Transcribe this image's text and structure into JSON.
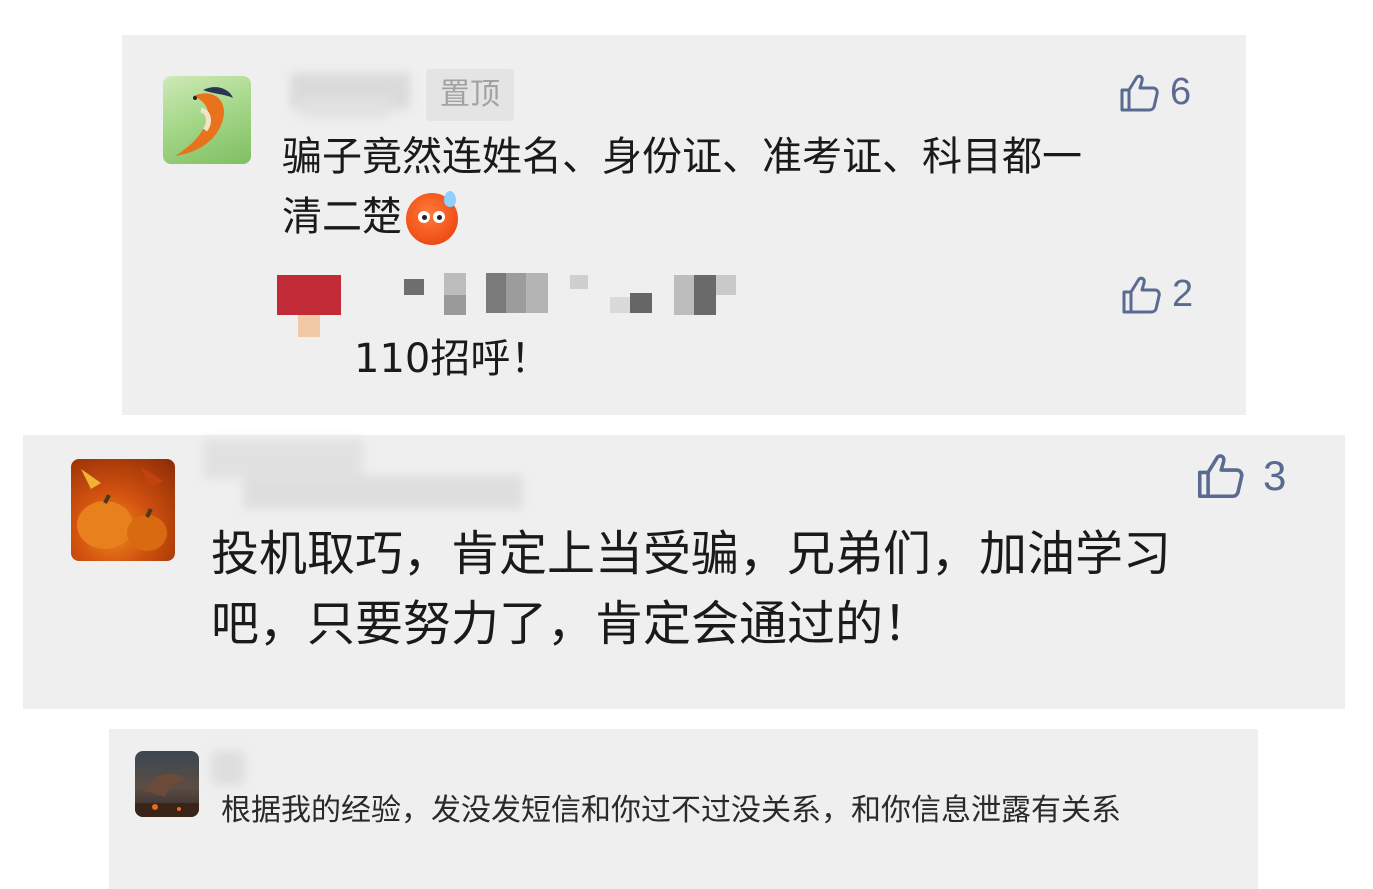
{
  "comments": [
    {
      "pinned_label": "置顶",
      "text_line1": "骗子竟然连姓名、身份证、准考证、科目都一",
      "text_line2": "清二楚",
      "likes": "6",
      "reply": {
        "text": "110招呼！",
        "likes": "2"
      }
    },
    {
      "text_line1": "投机取巧，肯定上当受骗，兄弟们，加油学习",
      "text_line2": "吧，只要努力了，肯定会通过的！",
      "likes": "3"
    },
    {
      "text_line1": "根据我的经验，发没发短信和你过不过没关系，和你信息泄露有关系"
    }
  ],
  "colors": {
    "card_bg": "#efefef",
    "like_color": "#5a6b91",
    "pinned_tag_bg": "#e4e4e4",
    "pinned_tag_text": "#a2a2a2"
  },
  "icons": {
    "like": "thumbs-up-outline-icon",
    "emoji": "sweat-face-emoji"
  }
}
